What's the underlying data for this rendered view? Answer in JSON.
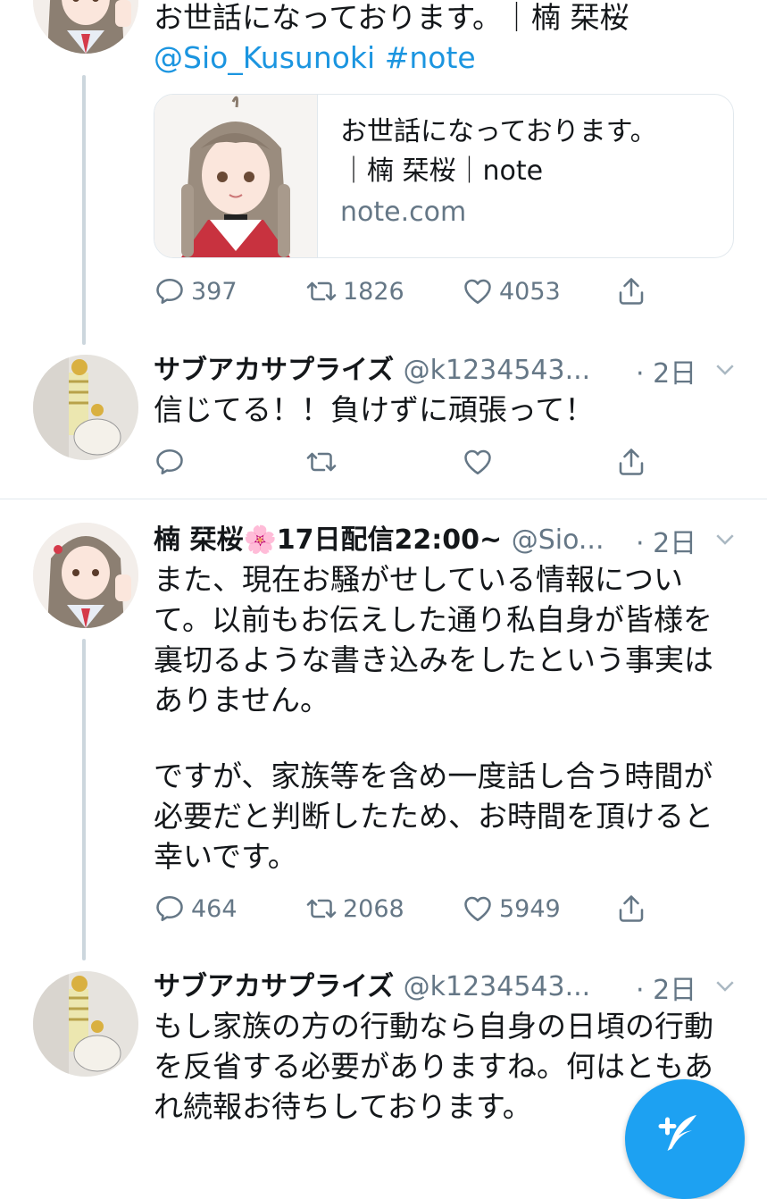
{
  "tweet1": {
    "text_line1": "お世話になっております。｜楠 栞桜",
    "mention": "@Sio_Kusunoki",
    "hashtag": "#note",
    "card": {
      "title_line1": "お世話になっております。",
      "title_line2": "｜楠 栞桜｜note",
      "domain": "note.com"
    },
    "replies": "397",
    "retweets": "1826",
    "likes": "4053"
  },
  "reply1": {
    "name": "サブアカサプライズ",
    "handle": "@k1234543...",
    "time": "· 2日",
    "text": "信じてる！！負けずに頑張って！"
  },
  "tweet2": {
    "name": "楠 栞桜🌸17日配信22:00~",
    "handle": "@Sio...",
    "time": "· 2日",
    "paragraph1": "また、現在お騒がせしている情報について。以前もお伝えした通り私自身が皆様を裏切るような書き込みをしたという事実はありません。",
    "paragraph2": "ですが、家族等を含め一度話し合う時間が必要だと判断したため、お時間を頂けると幸いです。",
    "replies": "464",
    "retweets": "2068",
    "likes": "5949"
  },
  "reply2": {
    "name": "サブアカサプライズ",
    "handle": "@k1234543...",
    "time": "· 2日",
    "text": "もし家族の方の行動なら自身の日頃の行動を反省する必要がありますね。何はともあれ続報お待ちしております。"
  },
  "icons": [
    "reply-icon",
    "retweet-icon",
    "like-icon",
    "share-icon",
    "chevron-down-icon",
    "compose-icon"
  ],
  "colors": {
    "link": "#1b95e0",
    "meta": "#657786",
    "accent": "#1da1f2",
    "thread_line": "#ccd6dd"
  }
}
